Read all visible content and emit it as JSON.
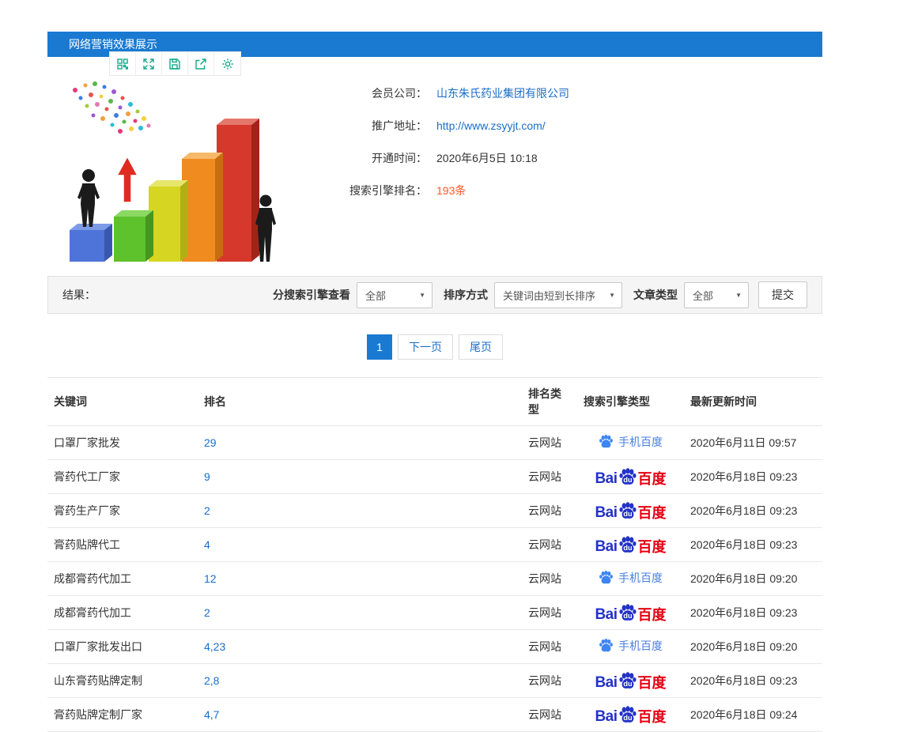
{
  "header": {
    "title": "网络营销效果展示"
  },
  "toolbar": {
    "icons": [
      "qrcode-icon",
      "fullscreen-icon",
      "save-icon",
      "share-icon",
      "settings-icon"
    ]
  },
  "info": {
    "fields": [
      {
        "label": "会员公司：",
        "value": "山东朱氏药业集团有限公司",
        "style": "link"
      },
      {
        "label": "推广地址：",
        "value": "http://www.zsyyjt.com/",
        "style": "link"
      },
      {
        "label": "开通时间：",
        "value": "2020年6月5日 10:18",
        "style": "text"
      },
      {
        "label": "搜索引擎排名：",
        "value": "193条",
        "style": "highlight"
      }
    ]
  },
  "filters": {
    "result_label": "结果：",
    "engine_label": "分搜索引擎查看",
    "engine_value": "全部",
    "sort_label": "排序方式",
    "sort_value": "关键词由短到长排序",
    "article_label": "文章类型",
    "article_value": "全部",
    "submit_label": "提交"
  },
  "pagination": {
    "current": "1",
    "next": "下一页",
    "last": "尾页"
  },
  "brand": {
    "baidu_bai": "Bai",
    "baidu_du": "du",
    "baidu_cn": "百度",
    "mobile_baidu": "手机百度"
  },
  "table": {
    "headers": [
      "关键词",
      "排名",
      "排名类型",
      "搜索引擎类型",
      "最新更新时间"
    ],
    "rows": [
      {
        "keyword": "口罩厂家批发",
        "rank": "29",
        "rank_type": "云网站",
        "engine": "mobile",
        "updated": "2020年6月11日 09:57"
      },
      {
        "keyword": "膏药代工厂家",
        "rank": "9",
        "rank_type": "云网站",
        "engine": "baidu",
        "updated": "2020年6月18日 09:23"
      },
      {
        "keyword": "膏药生产厂家",
        "rank": "2",
        "rank_type": "云网站",
        "engine": "baidu",
        "updated": "2020年6月18日 09:23"
      },
      {
        "keyword": "膏药贴牌代工",
        "rank": "4",
        "rank_type": "云网站",
        "engine": "baidu",
        "updated": "2020年6月18日 09:23"
      },
      {
        "keyword": "成都膏药代加工",
        "rank": "12",
        "rank_type": "云网站",
        "engine": "mobile",
        "updated": "2020年6月18日 09:20"
      },
      {
        "keyword": "成都膏药代加工",
        "rank": "2",
        "rank_type": "云网站",
        "engine": "baidu",
        "updated": "2020年6月18日 09:23"
      },
      {
        "keyword": "口罩厂家批发出口",
        "rank": "4,23",
        "rank_type": "云网站",
        "engine": "mobile",
        "updated": "2020年6月18日 09:20"
      },
      {
        "keyword": "山东膏药贴牌定制",
        "rank": "2,8",
        "rank_type": "云网站",
        "engine": "baidu",
        "updated": "2020年6月18日 09:23"
      },
      {
        "keyword": "膏药贴牌定制厂家",
        "rank": "4,7",
        "rank_type": "云网站",
        "engine": "baidu",
        "updated": "2020年6月18日 09:24"
      }
    ]
  },
  "colors": {
    "primary": "#1a7ad2",
    "link": "#1a6ec8",
    "highlight": "#ff5722",
    "baidu_blue": "#2332c8",
    "baidu_red": "#e60012",
    "toolbar_icon": "#16a98a"
  }
}
